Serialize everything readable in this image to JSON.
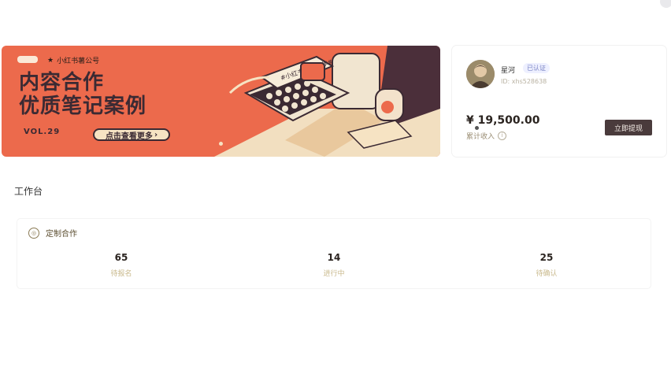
{
  "banner": {
    "brand": "小红书薯公号",
    "title_line1": "内容合作",
    "title_line2": "优质笔记案例",
    "vol": "VOL.29",
    "cta": "点击查看更多",
    "typewriter_text": "#小红书内容合作#"
  },
  "account": {
    "name": "星河",
    "badge": "已认证",
    "id": "ID: xhs528638",
    "balance": "¥ 19,500.00",
    "balance_label": "累计收入",
    "withdraw": "立即提现"
  },
  "workbench": {
    "title": "工作台",
    "panel_title": "定制合作",
    "stats": [
      {
        "value": "65",
        "label": "待报名"
      },
      {
        "value": "14",
        "label": "进行中"
      },
      {
        "value": "25",
        "label": "待确认"
      }
    ]
  }
}
